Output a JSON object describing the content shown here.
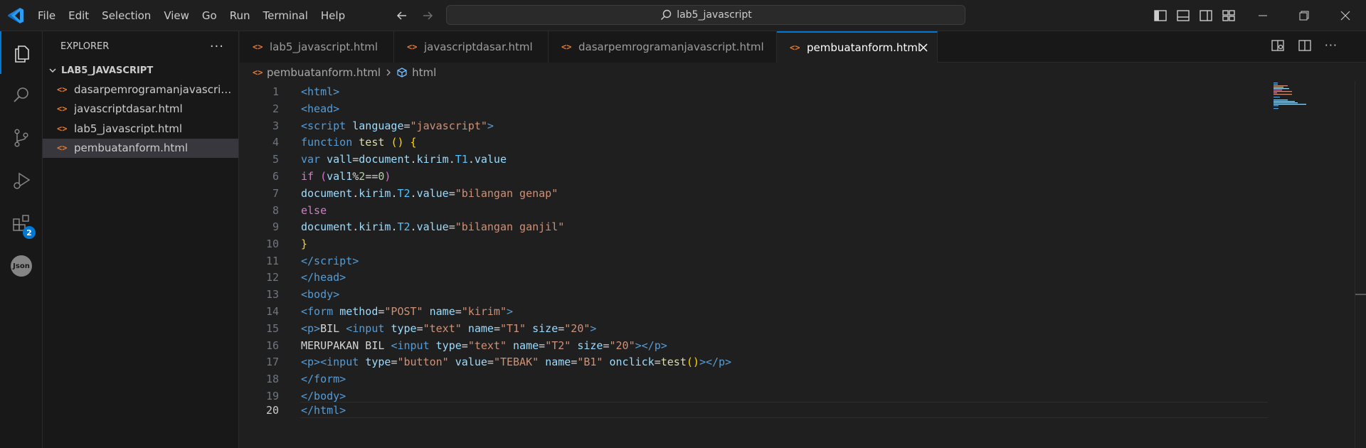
{
  "menu": [
    "File",
    "Edit",
    "Selection",
    "View",
    "Go",
    "Run",
    "Terminal",
    "Help"
  ],
  "search": {
    "text": "lab5_javascript"
  },
  "sidebar": {
    "title": "EXPLORER",
    "folder": "LAB5_JAVASCRIPT",
    "files": [
      "dasarpemrogramanjavascript.html",
      "javascriptdasar.html",
      "lab5_javascript.html",
      "pembuatanform.html"
    ],
    "selected_index": 3
  },
  "activity": {
    "extensions_badge": "2",
    "json_label": "Json"
  },
  "tabs": [
    "lab5_javascript.html",
    "javascriptdasar.html",
    "dasarpemrogramanjavascript.html",
    "pembuatanform.html"
  ],
  "active_tab_index": 3,
  "breadcrumb": {
    "file": "pembuatanform.html",
    "symbol": "html"
  },
  "editor": {
    "current_line": 20,
    "line_numbers": [
      "1",
      "2",
      "3",
      "4",
      "5",
      "6",
      "7",
      "8",
      "9",
      "10",
      "11",
      "12",
      "13",
      "14",
      "15",
      "16",
      "17",
      "18",
      "19",
      "20"
    ]
  },
  "colors": {
    "accent": "#0078d4",
    "html_icon": "#e37933",
    "background": "#1f1f1f"
  }
}
